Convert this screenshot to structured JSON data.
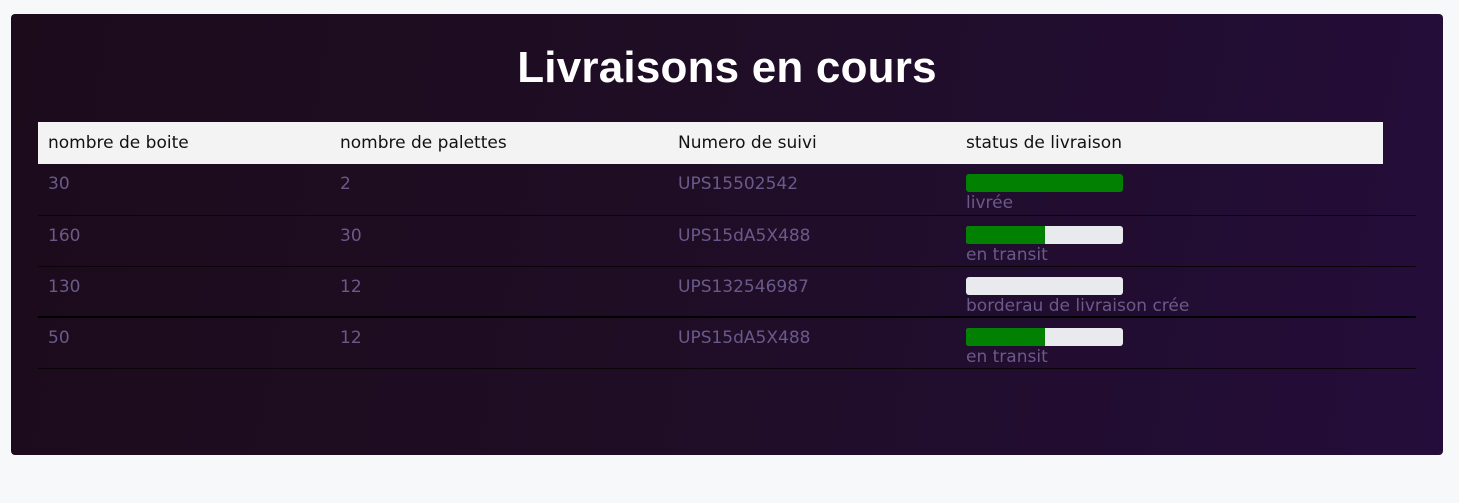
{
  "panel": {
    "title": "Livraisons en cours"
  },
  "table": {
    "headers": [
      "nombre de boite",
      "nombre de palettes",
      "Numero de suivi",
      "status de livraison"
    ],
    "rows": [
      {
        "boites": "30",
        "palettes": "2",
        "suivi": "UPS15502542",
        "status": "livrée",
        "progress": 1.0
      },
      {
        "boites": "160",
        "palettes": "30",
        "suivi": "UPS15dA5X488",
        "status": "en transit",
        "progress": 0.5
      },
      {
        "boites": "130",
        "palettes": "12",
        "suivi": "UPS132546987",
        "status": "borderau de livraison crée",
        "progress": 0.0
      },
      {
        "boites": "50",
        "palettes": "12",
        "suivi": "UPS15dA5X488",
        "status": "en transit",
        "progress": 0.5
      }
    ]
  },
  "colors": {
    "progress_fill": "#018001",
    "progress_track": "#e9eaee",
    "panel_bg_start": "#1c0b1b",
    "panel_bg_end": "#240d3a",
    "cell_text": "#6a5a8a"
  }
}
